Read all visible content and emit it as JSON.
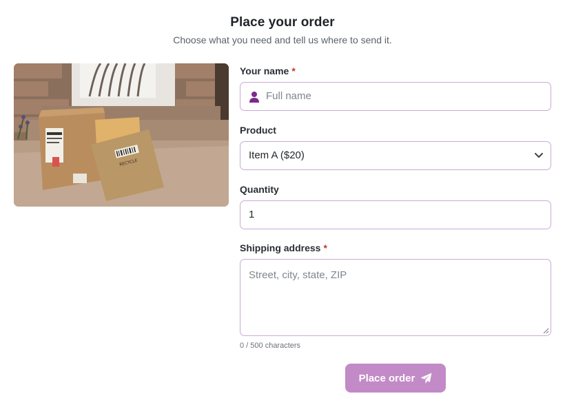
{
  "header": {
    "title": "Place your order",
    "subtitle": "Choose what you need and tell us where to send it."
  },
  "image": {
    "alt": "Cardboard box and padded envelopes on a doorstep",
    "stamp_text": "RECYCLE"
  },
  "form": {
    "name": {
      "label": "Your name",
      "required_mark": "*",
      "placeholder": "Full name",
      "value": ""
    },
    "product": {
      "label": "Product",
      "selected": "Item A ($20)"
    },
    "quantity": {
      "label": "Quantity",
      "value": "1"
    },
    "address": {
      "label": "Shipping address",
      "required_mark": "*",
      "placeholder": "Street, city, state, ZIP",
      "value": ""
    },
    "counter": "0 / 500 characters",
    "submit_label": "Place order"
  },
  "icons": {
    "name": "user-icon",
    "product": "chevron-down-icon",
    "submit": "paper-plane-icon"
  },
  "colors": {
    "accent": "#c28ac6",
    "border": "#c9a9d6",
    "icon": "#7b2a8c",
    "required": "#c0392b"
  }
}
